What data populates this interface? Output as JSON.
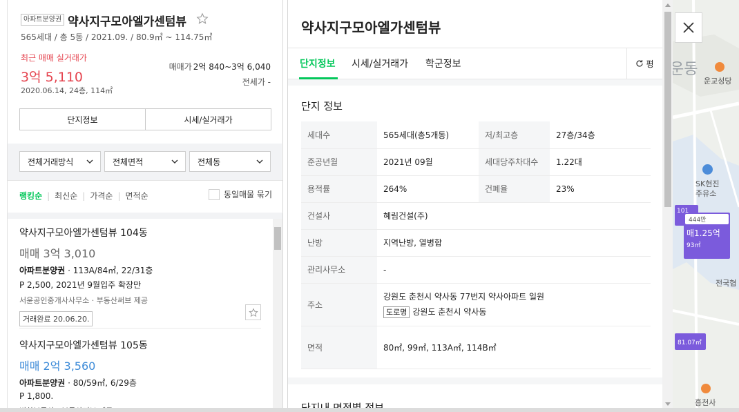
{
  "summary": {
    "badge": "아파트분양권",
    "title": "약사지구모아엘가센텀뷰",
    "meta": "565세대 / 총 5동 / 2021.09. / 80.9㎡ ~ 114.75㎡",
    "recent_label": "최근 매매 실거래가",
    "recent_price": "3억 5,110",
    "recent_date": "2020.06.14, 24층, 114㎡",
    "sale_label": "매매가",
    "sale_range": "2억 840~3억 6,040",
    "jeonse": "전세가 -",
    "tabs": [
      "단지정보",
      "시세/실거래가"
    ]
  },
  "filters": [
    "전체거래방식",
    "전체면적",
    "전체동"
  ],
  "sort": {
    "options": [
      "랭킹순",
      "최신순",
      "가격순",
      "면적순"
    ],
    "active": "랭킹순",
    "group_label": "동일매물 묶기"
  },
  "listings": [
    {
      "name": "약사지구모아엘가센텀뷰 104동",
      "price": "매매 3억 3,010",
      "type": "아파트분양권",
      "spec": " · 113A/84㎡, 22/31층",
      "desc": "P 2,500, 2021년 9월입주 확장만",
      "agents": "서윤공인중개사사무소 · 부동산써브 제공",
      "tag": "거래완료 20.06.20."
    },
    {
      "name": "약사지구모아엘가센텀뷰 105동",
      "price": "매매 2억 3,560",
      "type": "아파트분양권",
      "spec": " · 80/59㎡, 6/29층",
      "desc": "P 1,800.",
      "agents": "번창부동산 · 부동산써브 제공"
    }
  ],
  "detail": {
    "title": "약사지구모아엘가센텀뷰",
    "tabs": [
      "단지정보",
      "시세/실거래가",
      "학군정보"
    ],
    "active_tab": "단지정보",
    "pyeong_label": "평",
    "section_title": "단지 정보",
    "rows": {
      "households_k": "세대수",
      "households_v": "565세대(총5개동)",
      "floors_k": "저/최고층",
      "floors_v": "27층/34층",
      "built_k": "준공년월",
      "built_v": "2021년 09월",
      "parking_k": "세대당주차대수",
      "parking_v": "1.22대",
      "far_k": "용적률",
      "far_v": "264%",
      "bcr_k": "건폐율",
      "bcr_v": "23%",
      "builder_k": "건설사",
      "builder_v": "혜림건설(주)",
      "heating_k": "난방",
      "heating_v": "지역난방, 열병합",
      "office_k": "관리사무소",
      "office_v": "-",
      "address_k": "주소",
      "address_v": "강원도 춘천시 약사동 77번지 약사아파트 일원",
      "road_tag": "도로명",
      "road_v": "강원도 춘천시 약사동",
      "area_k": "면적",
      "area_v": "80㎡, 99㎡, 113A㎡, 114B㎡"
    },
    "next_section": "단지내 면적별 정보"
  },
  "map": {
    "labels": {
      "dong": "운동",
      "church": "운교성당",
      "gas1": "SK현진",
      "gas2": "주유소",
      "school": "전국협",
      "temple": "흥천사"
    },
    "marker_main": {
      "top": "444만",
      "price": "매1.25억",
      "area": "93㎡"
    },
    "marker_side": "101",
    "marker_low": "81.07㎡"
  },
  "colors": {
    "accent": "#03c75a",
    "price_red": "#e5444f",
    "price_blue": "#3d8bd8",
    "marker": "#7b5bdc"
  }
}
